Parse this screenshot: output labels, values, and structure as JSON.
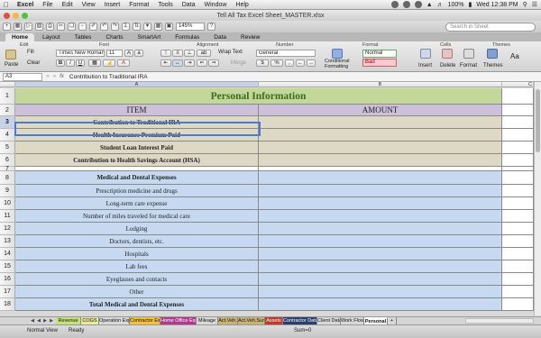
{
  "menubar": {
    "app": "Excel",
    "items": [
      "File",
      "Edit",
      "View",
      "Insert",
      "Format",
      "Tools",
      "Data",
      "Window",
      "Help"
    ],
    "battery": "100%",
    "clock": "Wed 12:38 PM"
  },
  "window": {
    "title": "Tell All Tax Excel Sheet_MASTER.xlsx"
  },
  "toolbar": {
    "zoom": "145%",
    "search_placeholder": "Search in Sheet"
  },
  "ribbon": {
    "tabs": [
      "Home",
      "Layout",
      "Tables",
      "Charts",
      "SmartArt",
      "Formulas",
      "Data",
      "Review"
    ],
    "active_tab": "Home",
    "groups": [
      "Edit",
      "Font",
      "Alignment",
      "Number",
      "Format",
      "Cells",
      "Themes"
    ],
    "paste": "Paste",
    "fill": "Fill",
    "clear": "Clear",
    "font_name": "Times New Roman",
    "font_size": "11",
    "wrap_text": "Wrap Text",
    "merge": "Merge",
    "number_format": "General",
    "conditional_formatting": "Conditional Formatting",
    "style_normal": "Normal",
    "style_bad": "Bad",
    "insert": "Insert",
    "delete": "Delete",
    "format": "Format",
    "themes": "Themes",
    "aa": "Aa"
  },
  "formula_bar": {
    "cell_ref": "A3",
    "fx": "fx",
    "content": "Contribution to Traditional IRA"
  },
  "sheet": {
    "columns": [
      "A",
      "B",
      "C"
    ],
    "title": "Personal Information",
    "header_item": "ITEM",
    "header_amount": "AMOUNT",
    "rows": [
      {
        "num": "1"
      },
      {
        "num": "2"
      },
      {
        "num": "3",
        "text": "Contribution to Traditional IRA"
      },
      {
        "num": "4",
        "text": "Health Insurance Premium Paid"
      },
      {
        "num": "5",
        "text": "Student Loan Interest Paid"
      },
      {
        "num": "6",
        "text": "Contribution to Health Savings Account (HSA)"
      },
      {
        "num": "7",
        "text": ""
      },
      {
        "num": "8",
        "text": "Medical and Dental Expenses"
      },
      {
        "num": "9",
        "text": "Prescription medicine and drugs"
      },
      {
        "num": "10",
        "text": "Long-term care expense"
      },
      {
        "num": "11",
        "text": "Number of miles traveled for medical care"
      },
      {
        "num": "12",
        "text": "Lodging"
      },
      {
        "num": "13",
        "text": "Doctors, dentists, etc."
      },
      {
        "num": "14",
        "text": "Hospitals"
      },
      {
        "num": "15",
        "text": "Lab fees"
      },
      {
        "num": "16",
        "text": "Eyeglasses and contacts"
      },
      {
        "num": "17",
        "text": "Other"
      },
      {
        "num": "18",
        "text": "Total Medical and Dental Expenses"
      }
    ]
  },
  "sheet_tabs": [
    {
      "label": "Revenue",
      "color": "#c7e07a"
    },
    {
      "label": "COGS",
      "color": "#e8e8a0"
    },
    {
      "label": "Operation Exp",
      "color": "#d9d9d9"
    },
    {
      "label": "Contractor Exp",
      "color": "#f2c043"
    },
    {
      "label": "Home Office Exp",
      "color": "#b23a8e"
    },
    {
      "label": "Mileage",
      "color": "#d9d9d9"
    },
    {
      "label": "Act.Veh.",
      "color": "#c9b37a"
    },
    {
      "label": "Act.Veh.Sum",
      "color": "#c9b37a"
    },
    {
      "label": "Assets",
      "color": "#c0392b"
    },
    {
      "label": "Contractor Data",
      "color": "#2c3e6b"
    },
    {
      "label": "Client Data",
      "color": "#d9d9d9"
    },
    {
      "label": "Work Flow",
      "color": "#d9d9d9"
    },
    {
      "label": "Personal",
      "color": "#ffffff"
    },
    {
      "label": "+",
      "color": "#d9d9d9"
    }
  ],
  "statusbar": {
    "view": "Normal View",
    "status": "Ready",
    "sum": "Sum=0"
  }
}
